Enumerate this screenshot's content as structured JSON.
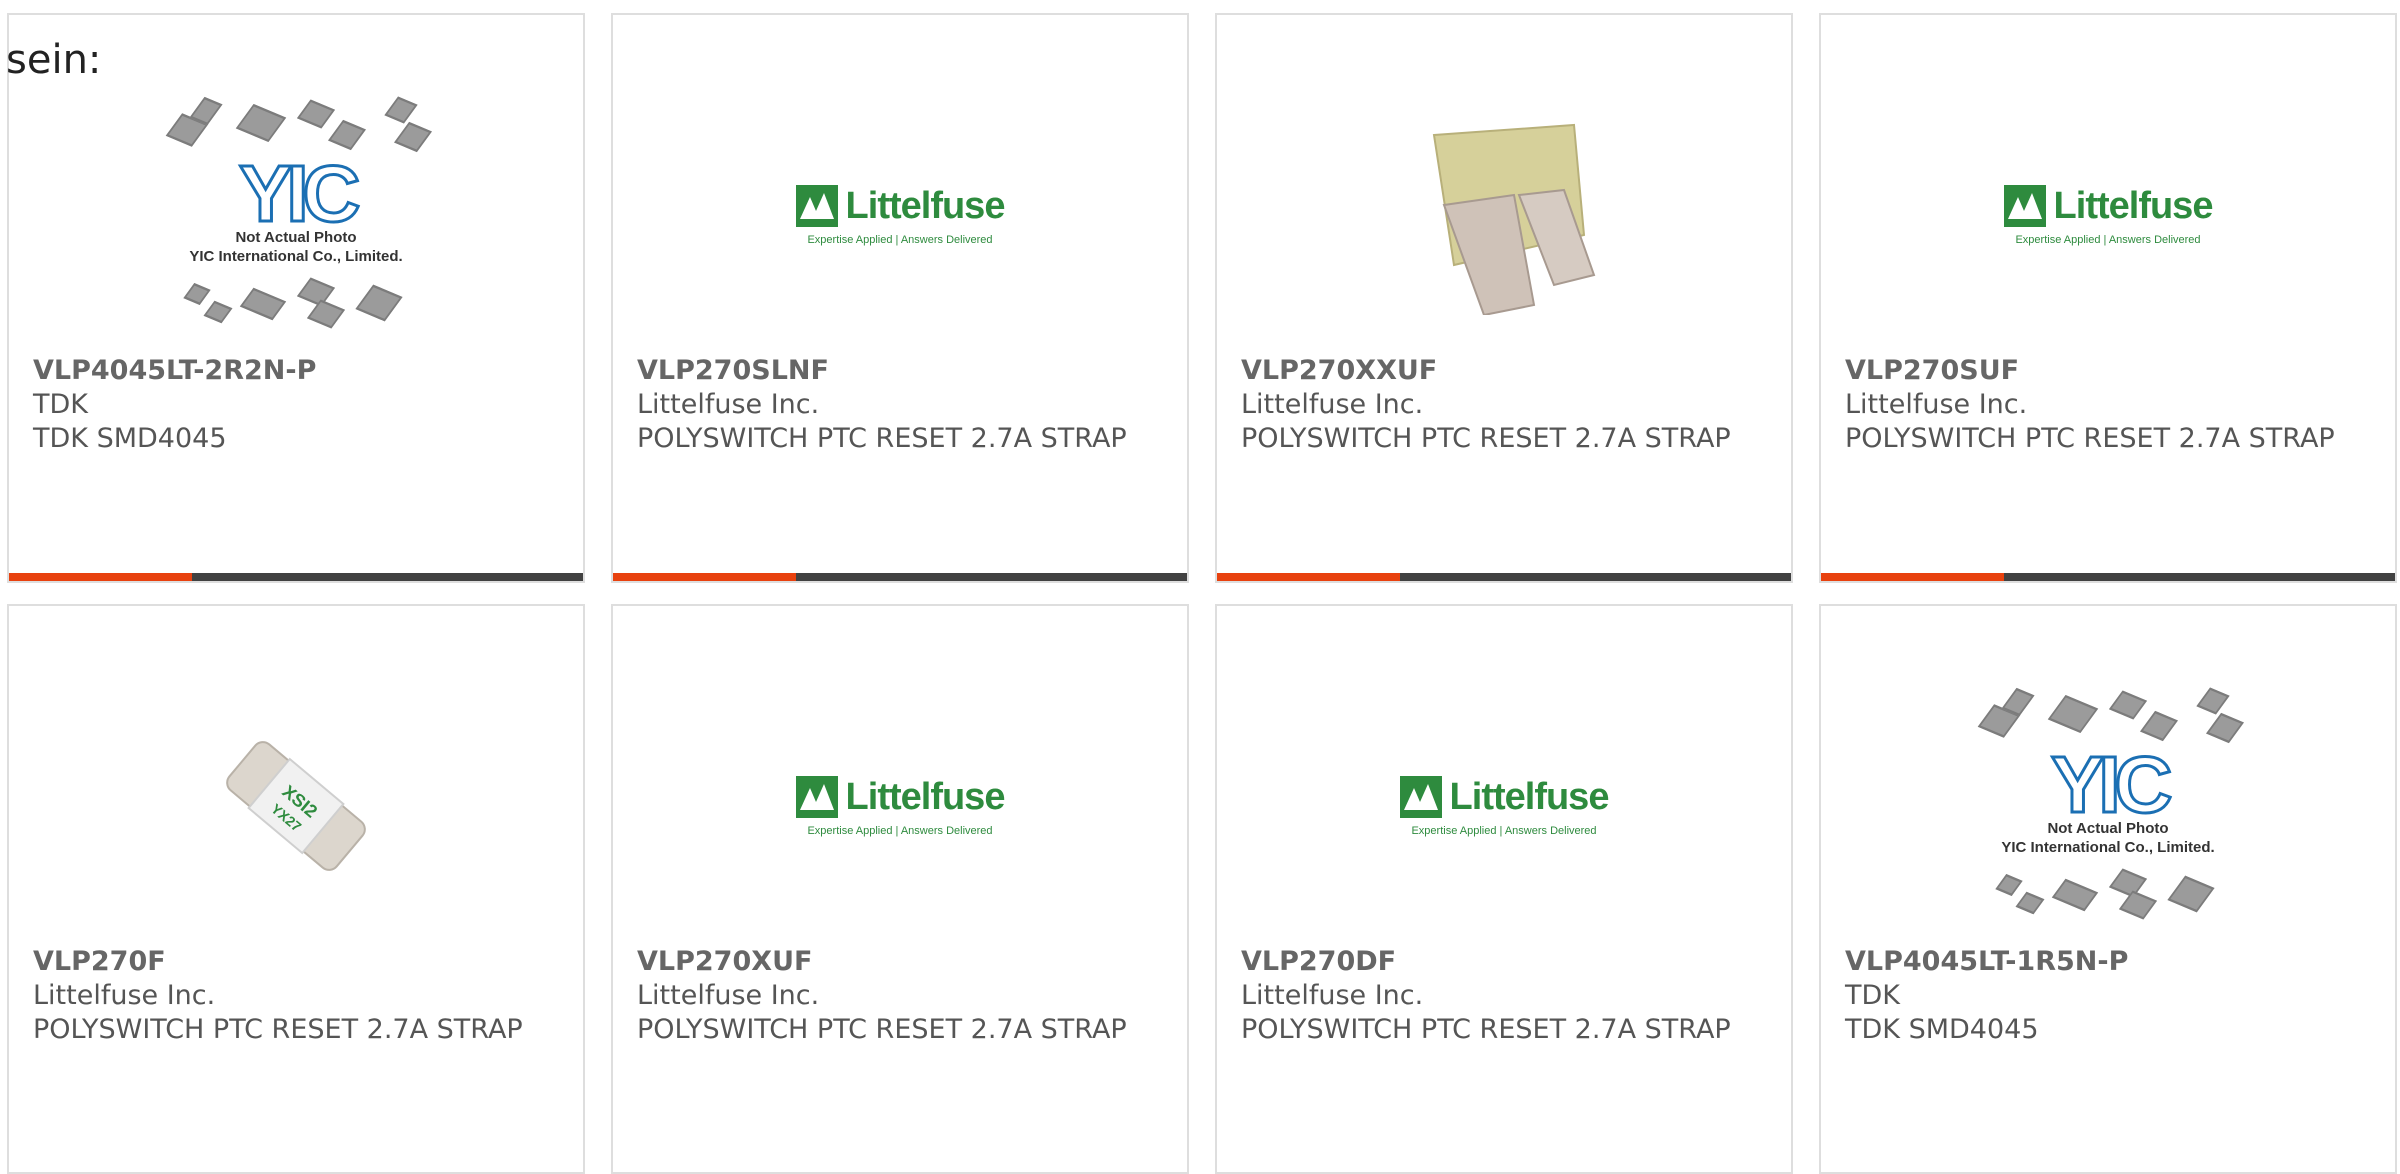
{
  "intro_text": "sein:",
  "products": [
    {
      "part_number": "VLP4045LT-2R2N-P",
      "manufacturer": "TDK",
      "description": "TDK SMD4045",
      "image": "yic-placeholder",
      "image_caption": [
        "Not Actual Photo",
        "YIC International Co., Limited."
      ]
    },
    {
      "part_number": "VLP270SLNF",
      "manufacturer": "Littelfuse Inc.",
      "description": "POLYSWITCH PTC RESET 2.7A STRAP",
      "image": "littelfuse-logo",
      "logo_name": "Littelfuse",
      "logo_tagline": "Expertise Applied | Answers Delivered"
    },
    {
      "part_number": "VLP270XXUF",
      "manufacturer": "Littelfuse Inc.",
      "description": "POLYSWITCH PTC RESET 2.7A STRAP",
      "image": "strap-photo"
    },
    {
      "part_number": "VLP270SUF",
      "manufacturer": "Littelfuse Inc.",
      "description": "POLYSWITCH PTC RESET 2.7A STRAP",
      "image": "littelfuse-logo",
      "logo_name": "Littelfuse",
      "logo_tagline": "Expertise Applied | Answers Delivered"
    },
    {
      "part_number": "VLP270F",
      "manufacturer": "Littelfuse Inc.",
      "description": "POLYSWITCH PTC RESET 2.7A STRAP",
      "image": "strap-label-photo"
    },
    {
      "part_number": "VLP270XUF",
      "manufacturer": "Littelfuse Inc.",
      "description": "POLYSWITCH PTC RESET 2.7A STRAP",
      "image": "littelfuse-logo",
      "logo_name": "Littelfuse",
      "logo_tagline": "Expertise Applied | Answers Delivered"
    },
    {
      "part_number": "VLP270DF",
      "manufacturer": "Littelfuse Inc.",
      "description": "POLYSWITCH PTC RESET 2.7A STRAP",
      "image": "littelfuse-logo",
      "logo_name": "Littelfuse",
      "logo_tagline": "Expertise Applied | Answers Delivered"
    },
    {
      "part_number": "VLP4045LT-1R5N-P",
      "manufacturer": "TDK",
      "description": "TDK SMD4045",
      "image": "yic-placeholder",
      "image_caption": [
        "Not Actual Photo",
        "YIC International Co., Limited."
      ]
    }
  ],
  "colors": {
    "accent": "#e8410e",
    "bar": "#414141",
    "littelfuse_green": "#2e8b3e",
    "yic_blue": "#1b6fb3"
  }
}
